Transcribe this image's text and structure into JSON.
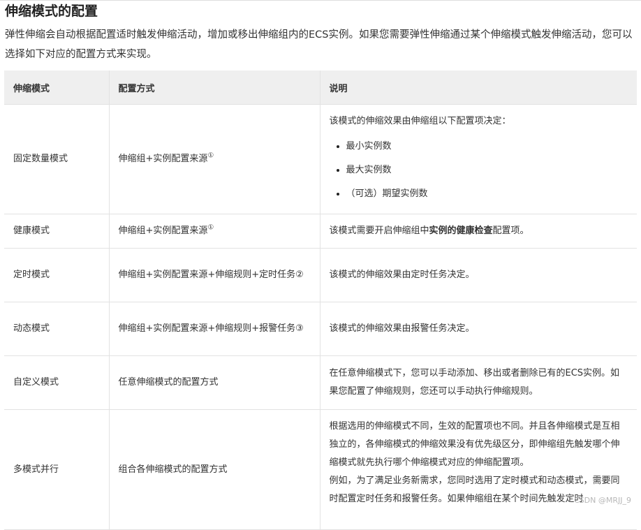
{
  "page": {
    "title": "伸缩模式的配置",
    "intro": "弹性伸缩会自动根据配置适时触发伸缩活动，增加或移出伸缩组内的ECS实例。如果您需要弹性伸缩通过某个伸缩模式触发伸缩活动，您可以选择如下对应的配置方式来实现。",
    "watermark": "CSDN @MRJJ_9"
  },
  "table": {
    "headers": [
      "伸缩模式",
      "配置方式",
      "说明"
    ],
    "rows": [
      {
        "mode": "固定数量模式",
        "config": "伸缩组+实例配置来源",
        "config_note": "①",
        "desc_intro": "该模式的伸缩效果由伸缩组以下配置项决定：",
        "desc_items": [
          "最小实例数",
          "最大实例数",
          "（可选）期望实例数"
        ]
      },
      {
        "mode": "健康模式",
        "config": "伸缩组+实例配置来源",
        "config_note": "①",
        "desc_pre": "该模式需要开启伸缩组中",
        "desc_bold": "实例的健康检查",
        "desc_post": "配置项。"
      },
      {
        "mode": "定时模式",
        "config": "伸缩组+实例配置来源+伸缩规则+定时任务②",
        "desc": "该模式的伸缩效果由定时任务决定。"
      },
      {
        "mode": "动态模式",
        "config": "伸缩组+实例配置来源+伸缩规则+报警任务③",
        "desc": "该模式的伸缩效果由报警任务决定。"
      },
      {
        "mode": "自定义模式",
        "config": "任意伸缩模式的配置方式",
        "desc": "在任意伸缩模式下，您可以手动添加、移出或者删除已有的ECS实例。如果您配置了伸缩规则，您还可以手动执行伸缩规则。"
      },
      {
        "mode": "多模式并行",
        "config": "组合各伸缩模式的配置方式",
        "desc_p1": "根据选用的伸缩模式不同，生效的配置项也不同。并且各伸缩模式是互相独立的，各伸缩模式的伸缩效果没有优先级区分，即伸缩组先触发哪个伸缩模式就先执行哪个伸缩模式对应的伸缩配置项。",
        "desc_p2": "例如，为了满足业务新需求，您同时选用了定时模式和动态模式，需要同时配置定时任务和报警任务。如果伸缩组在某个时间先触发定时"
      }
    ]
  }
}
